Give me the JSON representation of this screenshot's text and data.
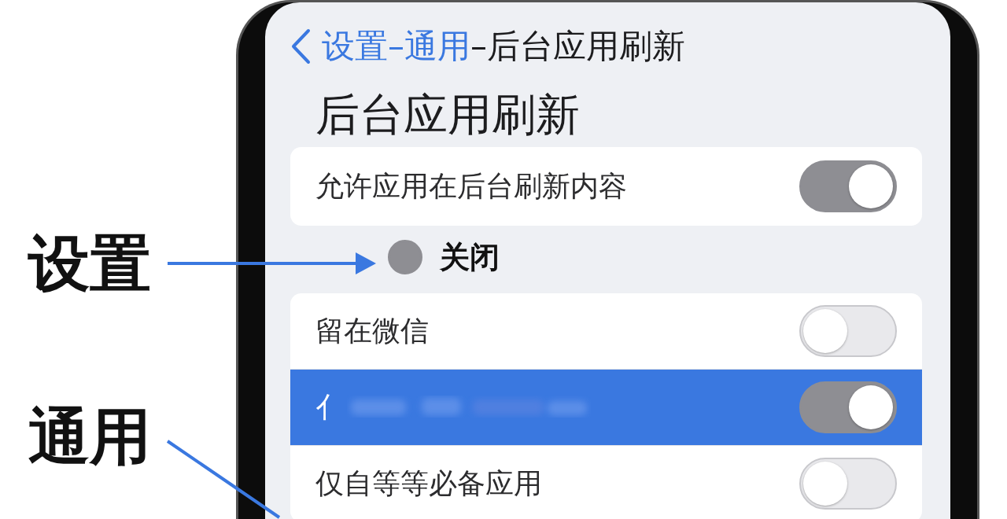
{
  "annotations": [
    {
      "label": "设置",
      "kind": "arrow"
    },
    {
      "label": "通用",
      "kind": "line"
    }
  ],
  "nav": {
    "breadcrumb": [
      {
        "text": "设置–通用",
        "kind": "link"
      },
      {
        "text": "–后台应用刷新",
        "kind": "current"
      }
    ]
  },
  "title": "后台应用刷新",
  "master": {
    "label": "允许应用在后台刷新内容",
    "on": true
  },
  "status": {
    "label": "关闭",
    "selected": true
  },
  "options": [
    {
      "label": "留在微信",
      "on": false,
      "selected": false,
      "blurred": false
    },
    {
      "label": "亻",
      "on": true,
      "selected": true,
      "blurred": true
    },
    {
      "label": "仅自等等必备应用",
      "on": false,
      "selected": false,
      "blurred": false
    }
  ]
}
